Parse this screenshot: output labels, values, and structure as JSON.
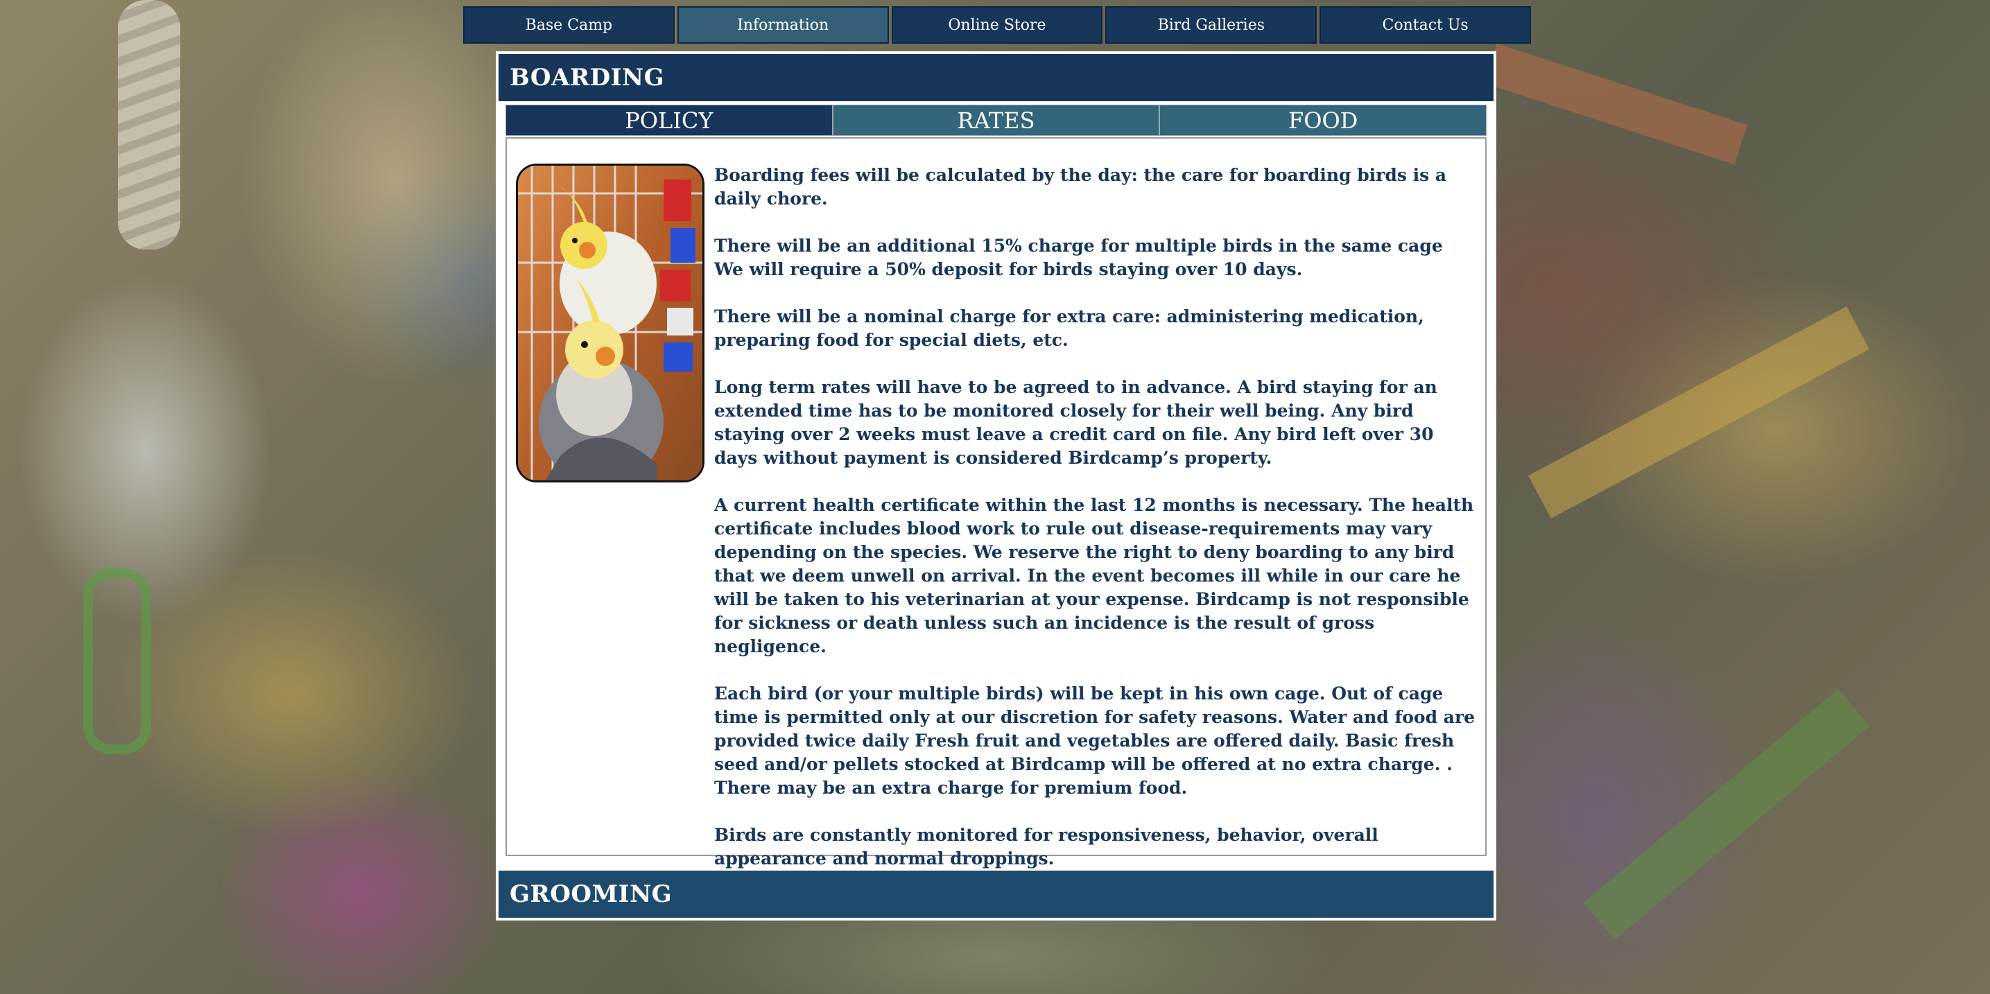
{
  "nav": {
    "items": [
      {
        "label": "Base Camp",
        "active": false
      },
      {
        "label": "Information",
        "active": true
      },
      {
        "label": "Online Store",
        "active": false
      },
      {
        "label": "Bird Galleries",
        "active": false
      },
      {
        "label": "Contact Us",
        "active": false
      }
    ]
  },
  "boarding": {
    "title": "BOARDING",
    "tabs": [
      {
        "label": "POLICY",
        "active": true
      },
      {
        "label": "RATES",
        "active": false
      },
      {
        "label": "FOOD",
        "active": false
      }
    ],
    "photo_icon": "cockatiel-photo",
    "paragraphs": [
      "Boarding fees will be calculated by the day: the care for boarding birds is a daily chore.",
      "There will be an additional 15% charge for multiple birds in the same cage",
      "We will require a 50% deposit for birds staying over 10 days.",
      "There will be a nominal charge for extra care: administering medication, preparing food for special diets, etc.",
      "Long term rates will have to be agreed to in advance.  A bird staying for an extended time has to be monitored closely for their well being.  Any bird staying over 2 weeks must leave a credit card on file.  Any bird left over 30 days without payment is considered Birdcamp’s property.",
      "A current health certificate within the last 12 months is necessary. The health certificate includes blood work to rule out disease-requirements may vary depending on the species. We reserve the right to deny boarding to any bird that we deem unwell on arrival. In the event becomes ill while in our care he will be taken to his veterinarian at your expense. Birdcamp is not responsible for sickness or death unless such an incidence is the result of gross negligence.",
      "Each bird (or your multiple birds) will be kept in his own cage. Out of cage time is permitted only at our discretion for safety reasons.  Water and food are provided twice daily Fresh fruit and vegetables are offered daily. Basic fresh seed and/or pellets stocked at Birdcamp will be offered at no extra charge. .  There may be an extra charge for premium food.",
      "Birds are constantly monitored for responsiveness, behavior, overall appearance and normal droppings."
    ]
  },
  "grooming": {
    "title": "GROOMING"
  },
  "colors": {
    "nav_bg": "#17365a",
    "nav_active": "#335f78",
    "tab_bg": "#34667b",
    "tab_active": "#17365a",
    "text": "#17365a"
  }
}
